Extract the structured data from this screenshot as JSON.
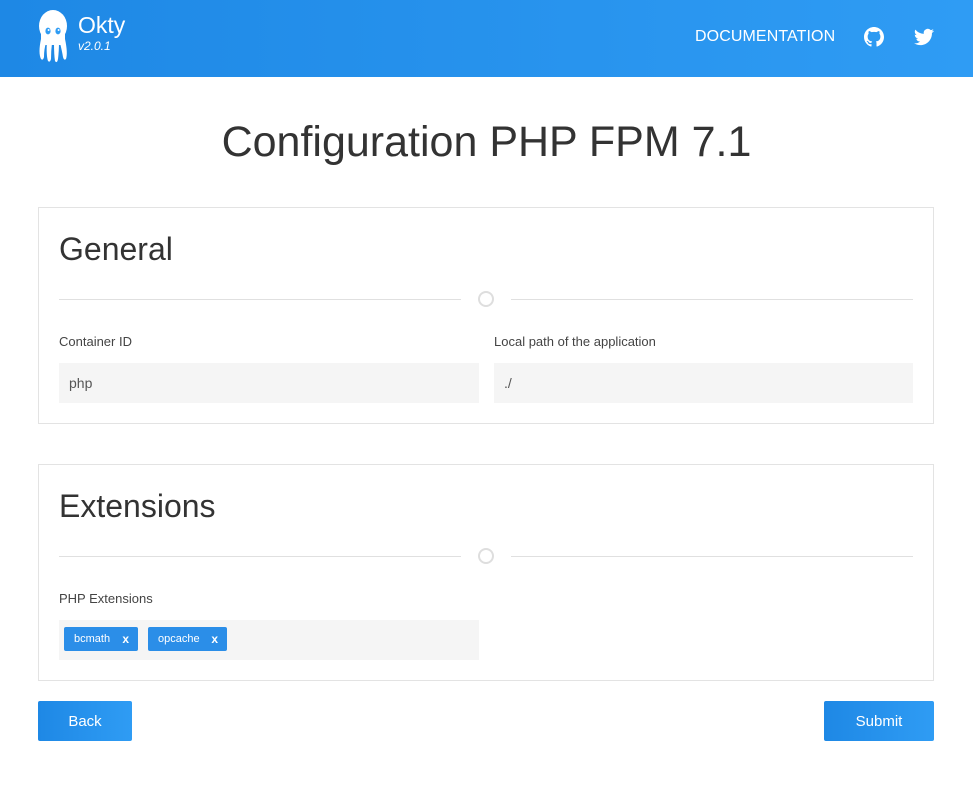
{
  "navbar": {
    "brand_name": "Okty",
    "brand_version": "v2.0.1",
    "documentation_label": "DOCUMENTATION",
    "icons": [
      "octopus-logo-icon",
      "github-icon",
      "twitter-icon"
    ]
  },
  "page": {
    "title": "Configuration PHP FPM 7.1"
  },
  "general": {
    "title": "General",
    "container_id_label": "Container ID",
    "container_id_value": "php",
    "local_path_label": "Local path of the application",
    "local_path_value": "./"
  },
  "extensions": {
    "title": "Extensions",
    "php_extensions_label": "PHP Extensions",
    "tags": [
      {
        "label": "bcmath",
        "remove": "x"
      },
      {
        "label": "opcache",
        "remove": "x"
      }
    ]
  },
  "actions": {
    "back_label": "Back",
    "submit_label": "Submit"
  },
  "colors": {
    "primary": "#1e88e5",
    "primary_light": "#2f9cf4",
    "input_bg": "#f5f5f5",
    "border": "#e3e3e3"
  }
}
